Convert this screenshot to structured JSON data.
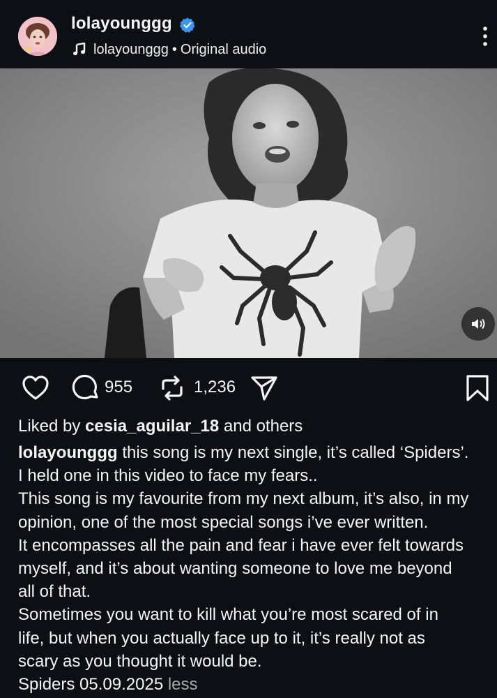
{
  "post": {
    "username": "lolayounggg",
    "audio": {
      "artist": "lolayounggg",
      "separator": "•",
      "title": "Original audio"
    }
  },
  "icons": {
    "verified": "verified-badge-icon",
    "music": "music-note-icon",
    "more": "more-vertical-icon",
    "mute": "speaker-icon",
    "like": "heart-icon",
    "comment": "comment-icon",
    "repost": "repost-icon",
    "share": "send-icon",
    "save": "bookmark-icon"
  },
  "colors": {
    "background": "#0c1014",
    "text": "#f5f5f5",
    "muted": "#a8a8a8",
    "verified": "#3897f0"
  },
  "actions": {
    "comments_count": "955",
    "reposts_count": "1,236"
  },
  "likes": {
    "prefix": "Liked by",
    "user": "cesia_aguilar_18",
    "suffix": "and others"
  },
  "caption": {
    "author": "lolayounggg",
    "lines": [
      "this song is my next single, it’s called ‘Spiders’.",
      "I held one in this video to face my fears..",
      "This song is my favourite from my next album, it’s also, in my",
      "opinion, one of the most special songs i’ve ever written.",
      "It encompasses all the pain and fear i have ever felt towards",
      "myself, and it’s about wanting someone to love me beyond",
      "all of that.",
      "Sometimes you want to kill what you’re most scared of in",
      "life, but when you actually face up to it, it’s really not as",
      "scary as you thought it would be.",
      "Spiders 05.09.2025"
    ],
    "less_label": "less"
  }
}
